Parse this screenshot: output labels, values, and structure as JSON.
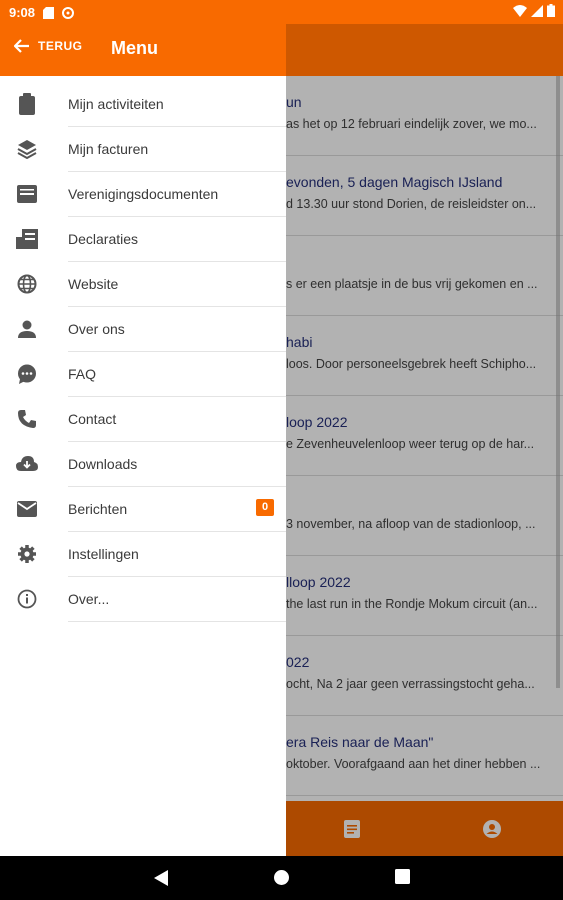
{
  "status_bar": {
    "time": "9:08",
    "icons": [
      "sd-card-icon",
      "data-saver-icon",
      "wifi-icon",
      "signal-icon",
      "battery-icon"
    ]
  },
  "drawer": {
    "back_label": "TERUG",
    "title": "Menu",
    "items": [
      {
        "label": "Mijn activiteiten",
        "icon": "clipboard-icon"
      },
      {
        "label": "Mijn facturen",
        "icon": "layers-icon"
      },
      {
        "label": "Verenigingsdocumenten",
        "icon": "archive-icon"
      },
      {
        "label": "Declaraties",
        "icon": "receipt-icon"
      },
      {
        "label": "Website",
        "icon": "globe-icon"
      },
      {
        "label": "Over ons",
        "icon": "person-icon"
      },
      {
        "label": "FAQ",
        "icon": "chat-icon"
      },
      {
        "label": "Contact",
        "icon": "phone-icon"
      },
      {
        "label": "Downloads",
        "icon": "cloud-download-icon"
      },
      {
        "label": "Berichten",
        "icon": "mail-icon",
        "badge": "0"
      },
      {
        "label": "Instellingen",
        "icon": "gear-icon"
      },
      {
        "label": "Over...",
        "icon": "info-icon"
      }
    ]
  },
  "news": [
    {
      "title": "un",
      "excerpt": "as het op 12 februari eindelijk zover, we mo..."
    },
    {
      "title": "evonden, 5 dagen Magisch IJsland",
      "excerpt": "d 13.30 uur stond Dorien, de reisleidster on..."
    },
    {
      "title": "",
      "excerpt": "s er een plaatsje in de bus vrij gekomen en ..."
    },
    {
      "title": "habi",
      "excerpt": "loos. Door personeelsgebrek heeft Schipho..."
    },
    {
      "title": "loop 2022",
      "excerpt": "e Zevenheuvelenloop weer terug op de har..."
    },
    {
      "title": "",
      "excerpt": "3 november, na afloop van de stadionloop, ..."
    },
    {
      "title": "lloop 2022",
      "excerpt": "the last run in the Rondje Mokum circuit (an..."
    },
    {
      "title": "022",
      "excerpt": "ocht, Na 2 jaar geen verrassingstocht geha..."
    },
    {
      "title": "era Reis naar de Maan\"",
      "excerpt": "oktober. Voorafgaand aan het diner hebben ..."
    }
  ],
  "bottom_nav": {
    "icons": [
      "document-icon",
      "account-icon"
    ]
  },
  "colors": {
    "accent": "#f86a00",
    "title_text": "#26307a"
  }
}
